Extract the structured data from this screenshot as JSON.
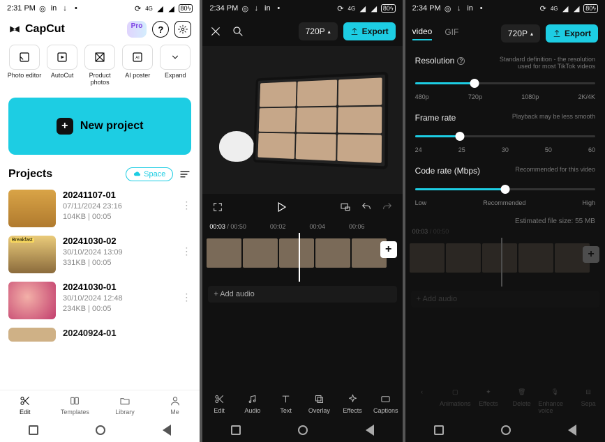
{
  "status1": {
    "time": "2:31 PM",
    "batt": "80"
  },
  "status2": {
    "time": "2:34 PM",
    "batt": "80"
  },
  "status3": {
    "time": "2:34 PM",
    "batt": "80"
  },
  "screen1": {
    "brand": "CapCut",
    "badge": "Pro",
    "tools": [
      {
        "label": "Photo editor"
      },
      {
        "label": "AutoCut"
      },
      {
        "label": "Product photos"
      },
      {
        "label": "AI poster"
      },
      {
        "label": "Expand"
      }
    ],
    "new_project": "New project",
    "projects_heading": "Projects",
    "space_label": "Space",
    "projects": [
      {
        "title": "20241107-01",
        "date": "07/11/2024 23:16",
        "meta": "104KB  |  00:05",
        "color": "#d9a447"
      },
      {
        "title": "20241030-02",
        "date": "30/10/2024 13:09",
        "meta": "331KB  |  00:05",
        "color": "#c7a05a"
      },
      {
        "title": "20241030-01",
        "date": "30/10/2024 12:48",
        "meta": "234KB  |  00:05",
        "color": "#d44f7c"
      },
      {
        "title": "20240924-01",
        "date": "",
        "meta": "",
        "color": "#caa97a"
      }
    ],
    "bottom_nav": [
      {
        "label": "Edit"
      },
      {
        "label": "Templates"
      },
      {
        "label": "Library"
      },
      {
        "label": "Me"
      }
    ]
  },
  "screen2": {
    "quality": "720P",
    "export": "Export",
    "time_current": "00:03",
    "time_total": "00:50",
    "ruler": [
      "00:02",
      "00:04",
      "00:06"
    ],
    "add_audio": "+  Add audio",
    "nav": [
      {
        "label": "Edit"
      },
      {
        "label": "Audio"
      },
      {
        "label": "Text"
      },
      {
        "label": "Overlay"
      },
      {
        "label": "Effects"
      },
      {
        "label": "Captions"
      }
    ]
  },
  "screen3": {
    "tabs": {
      "video": "video",
      "gif": "GIF"
    },
    "quality": "720P",
    "export": "Export",
    "resolution": {
      "title": "Resolution",
      "hint": "Standard definition - the resolution used for most TikTok videos",
      "ticks": [
        "480p",
        "720p",
        "1080p",
        "2K/4K"
      ],
      "value_pct": 33
    },
    "frame_rate": {
      "title": "Frame rate",
      "hint": "Playback may be less smooth",
      "ticks": [
        "24",
        "25",
        "30",
        "50",
        "60"
      ],
      "value_pct": 25
    },
    "code_rate": {
      "title": "Code rate (Mbps)",
      "hint": "Recommended for this video",
      "ticks": [
        "Low",
        "Recommended",
        "High"
      ],
      "value_pct": 50
    },
    "estimated": "Estimated file size: 55 MB",
    "dim_ruler_cur": "00:03",
    "dim_ruler_total": "00:50",
    "add_audio": "+  Add audio",
    "nav_dim": [
      {
        "label": "Animations"
      },
      {
        "label": "Effects"
      },
      {
        "label": "Delete"
      },
      {
        "label": "Enhance voice"
      },
      {
        "label": "Sepa"
      }
    ]
  }
}
